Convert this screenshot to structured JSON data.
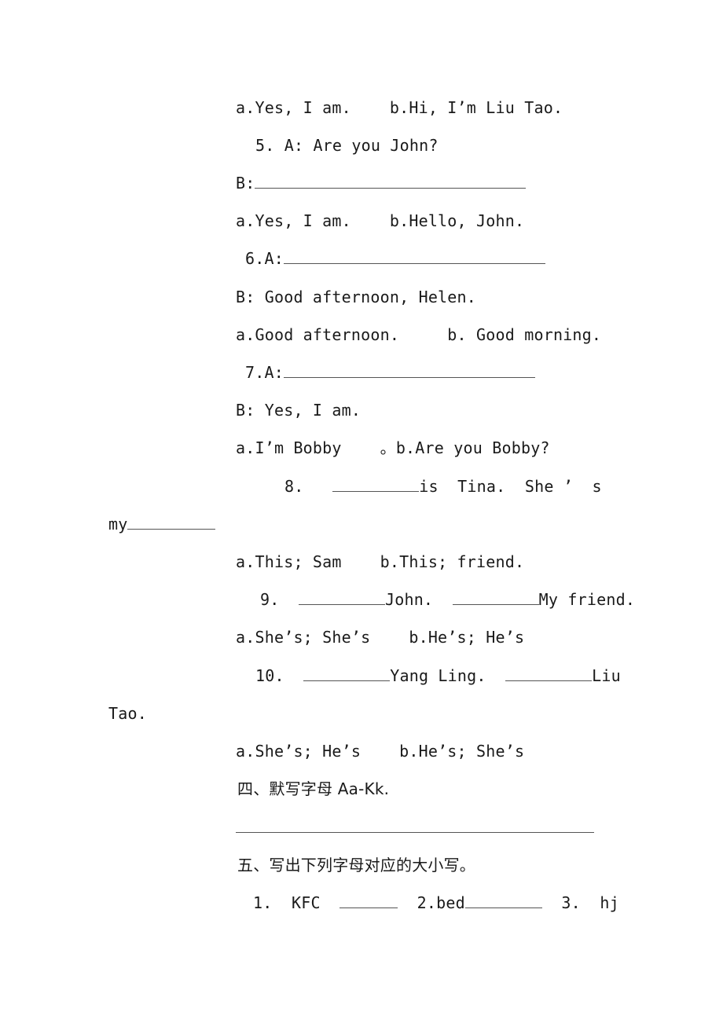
{
  "lines": {
    "q4_options": "a.Yes, I am.    b.Hi, I’m Liu Tao.",
    "q5_prompt": "5. A: Are you John?",
    "q5_answer_label": "B:",
    "q5_options": "a.Yes, I am.    b.Hello, John.",
    "q6_prompt_label": "6.A:",
    "q6_reply": "B: Good afternoon, Helen.",
    "q6_options": "a.Good afternoon.     b. Good morning.",
    "q7_prompt_label": "7.A:",
    "q7_reply": "B: Yes, I am.",
    "q7_options": "a.I’m Bobby    。b.Are you Bobby?",
    "q8_number": "8.",
    "q8_text": "is  Tina.  She ’  s",
    "q8_cont": "my",
    "q8_options": "a.This; Sam    b.This; friend.",
    "q9_number": "9.",
    "q9_text1": "John.",
    "q9_text2": "My friend.",
    "q9_options": "a.She’s; She’s    b.He’s; He’s",
    "q10_number": "10.",
    "q10_text1": "Yang Ling.",
    "q10_text2": "Liu",
    "q10_cont": "Tao.",
    "q10_options": "a.She’s; He’s    b.He’s; She’s",
    "section4_title": "四、默写字母 Aa-Kk.",
    "section5_title": "五、写出下列字母对应的大小写。",
    "s5_item1_label": "1.  KFC",
    "s5_item2_label": "2.bed",
    "s5_item3_label": "3.  hj"
  }
}
